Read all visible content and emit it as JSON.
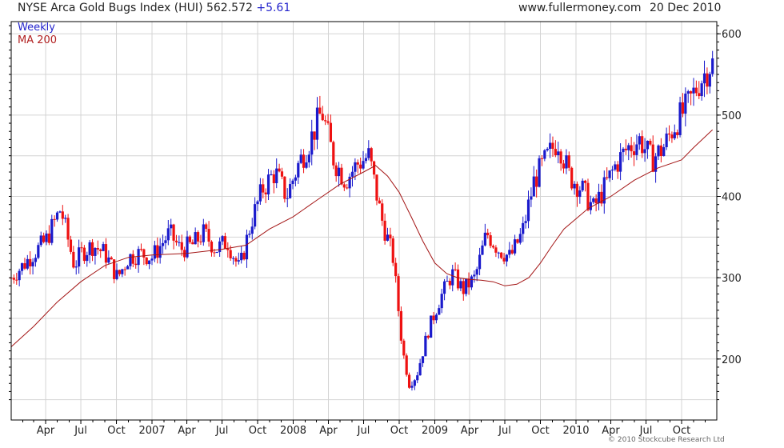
{
  "header": {
    "title": "NYSE Arca Gold Bugs Index (HUI)",
    "last_value": "562.572",
    "change": "+5.61",
    "site": "www.fullermoney.com",
    "date": "20 Dec 2010"
  },
  "footer": {
    "copyright": "© 2010 Stockcube Research Ltd"
  },
  "colors": {
    "up": "#1a1acc",
    "down": "#ee1111",
    "ma": "#a31515",
    "grid": "#d4d4d4",
    "frame": "#000000"
  },
  "chart_data": {
    "type": "bar",
    "subtype": "weekly high-low price bars with 200-day moving average",
    "title": "NYSE Arca Gold Bugs Index (HUI)",
    "ylim": [
      125,
      615
    ],
    "y_ticks": [
      200,
      300,
      400,
      500,
      600
    ],
    "x_ticks": [
      {
        "label": "Apr",
        "date": "2006-04"
      },
      {
        "label": "Jul",
        "date": "2006-07"
      },
      {
        "label": "Oct",
        "date": "2006-10"
      },
      {
        "label": "2007",
        "date": "2007-01"
      },
      {
        "label": "Apr",
        "date": "2007-04"
      },
      {
        "label": "Jul",
        "date": "2007-07"
      },
      {
        "label": "Oct",
        "date": "2007-10"
      },
      {
        "label": "2008",
        "date": "2008-01"
      },
      {
        "label": "Apr",
        "date": "2008-04"
      },
      {
        "label": "Jul",
        "date": "2008-07"
      },
      {
        "label": "Oct",
        "date": "2008-10"
      },
      {
        "label": "2009",
        "date": "2009-01"
      },
      {
        "label": "Apr",
        "date": "2009-04"
      },
      {
        "label": "Jul",
        "date": "2009-07"
      },
      {
        "label": "Oct",
        "date": "2009-10"
      },
      {
        "label": "2010",
        "date": "2010-01"
      },
      {
        "label": "Apr",
        "date": "2010-04"
      },
      {
        "label": "Jul",
        "date": "2010-07"
      },
      {
        "label": "Oct",
        "date": "2010-10"
      }
    ],
    "x_range": [
      "2006-01-02",
      "2010-12-31"
    ],
    "grid": true,
    "legend": "top-left",
    "series": [
      {
        "name": "Weekly",
        "kind": "price",
        "points": [
          [
            "2006-01-02",
            300
          ],
          [
            "2006-02-01",
            315
          ],
          [
            "2006-03-01",
            330
          ],
          [
            "2006-04-01",
            345
          ],
          [
            "2006-05-10",
            385
          ],
          [
            "2006-06-14",
            315
          ],
          [
            "2006-07-01",
            330
          ],
          [
            "2006-08-01",
            340
          ],
          [
            "2006-09-01",
            330
          ],
          [
            "2006-10-04",
            300
          ],
          [
            "2006-11-01",
            325
          ],
          [
            "2006-12-01",
            330
          ],
          [
            "2007-01-01",
            325
          ],
          [
            "2007-02-15",
            355
          ],
          [
            "2007-03-15",
            335
          ],
          [
            "2007-04-15",
            340
          ],
          [
            "2007-05-15",
            355
          ],
          [
            "2007-06-15",
            335
          ],
          [
            "2007-07-15",
            345
          ],
          [
            "2007-08-15",
            310
          ],
          [
            "2007-09-15",
            370
          ],
          [
            "2007-10-15",
            410
          ],
          [
            "2007-11-15",
            430
          ],
          [
            "2007-12-15",
            400
          ],
          [
            "2008-01-15",
            440
          ],
          [
            "2008-02-15",
            470
          ],
          [
            "2008-03-15",
            505
          ],
          [
            "2008-04-15",
            445
          ],
          [
            "2008-05-15",
            420
          ],
          [
            "2008-06-15",
            440
          ],
          [
            "2008-07-15",
            450
          ],
          [
            "2008-08-15",
            375
          ],
          [
            "2008-09-15",
            325
          ],
          [
            "2008-10-10",
            210
          ],
          [
            "2008-10-27",
            170
          ],
          [
            "2008-11-15",
            180
          ],
          [
            "2008-12-15",
            235
          ],
          [
            "2009-01-15",
            275
          ],
          [
            "2009-02-15",
            305
          ],
          [
            "2009-03-15",
            285
          ],
          [
            "2009-04-15",
            300
          ],
          [
            "2009-05-15",
            355
          ],
          [
            "2009-06-15",
            335
          ],
          [
            "2009-07-15",
            325
          ],
          [
            "2009-08-15",
            355
          ],
          [
            "2009-09-15",
            420
          ],
          [
            "2009-10-15",
            445
          ],
          [
            "2009-11-15",
            470
          ],
          [
            "2009-12-15",
            425
          ],
          [
            "2010-01-15",
            410
          ],
          [
            "2010-02-15",
            385
          ],
          [
            "2010-03-15",
            410
          ],
          [
            "2010-04-15",
            440
          ],
          [
            "2010-05-15",
            460
          ],
          [
            "2010-06-15",
            470
          ],
          [
            "2010-07-15",
            445
          ],
          [
            "2010-08-15",
            460
          ],
          [
            "2010-09-15",
            490
          ],
          [
            "2010-10-15",
            510
          ],
          [
            "2010-11-15",
            540
          ],
          [
            "2010-12-15",
            563
          ]
        ]
      },
      {
        "name": "MA 200",
        "kind": "moving-average",
        "points": [
          [
            "2006-01-02",
            215
          ],
          [
            "2006-03-01",
            240
          ],
          [
            "2006-05-01",
            270
          ],
          [
            "2006-07-01",
            295
          ],
          [
            "2006-09-01",
            315
          ],
          [
            "2006-11-01",
            325
          ],
          [
            "2007-01-01",
            328
          ],
          [
            "2007-04-01",
            330
          ],
          [
            "2007-07-01",
            335
          ],
          [
            "2007-09-01",
            340
          ],
          [
            "2007-11-01",
            360
          ],
          [
            "2008-01-01",
            375
          ],
          [
            "2008-03-01",
            395
          ],
          [
            "2008-05-01",
            415
          ],
          [
            "2008-07-01",
            430
          ],
          [
            "2008-08-01",
            438
          ],
          [
            "2008-09-01",
            425
          ],
          [
            "2008-10-01",
            405
          ],
          [
            "2008-11-01",
            375
          ],
          [
            "2008-12-01",
            345
          ],
          [
            "2009-01-01",
            318
          ],
          [
            "2009-02-01",
            305
          ],
          [
            "2009-03-01",
            300
          ],
          [
            "2009-04-01",
            298
          ],
          [
            "2009-05-01",
            297
          ],
          [
            "2009-06-01",
            295
          ],
          [
            "2009-07-01",
            290
          ],
          [
            "2009-08-01",
            292
          ],
          [
            "2009-09-01",
            300
          ],
          [
            "2009-10-01",
            318
          ],
          [
            "2009-11-01",
            340
          ],
          [
            "2009-12-01",
            360
          ],
          [
            "2010-02-01",
            385
          ],
          [
            "2010-04-01",
            400
          ],
          [
            "2010-06-01",
            420
          ],
          [
            "2010-08-01",
            435
          ],
          [
            "2010-10-01",
            445
          ],
          [
            "2010-11-01",
            460
          ],
          [
            "2010-12-20",
            482
          ]
        ]
      }
    ]
  }
}
